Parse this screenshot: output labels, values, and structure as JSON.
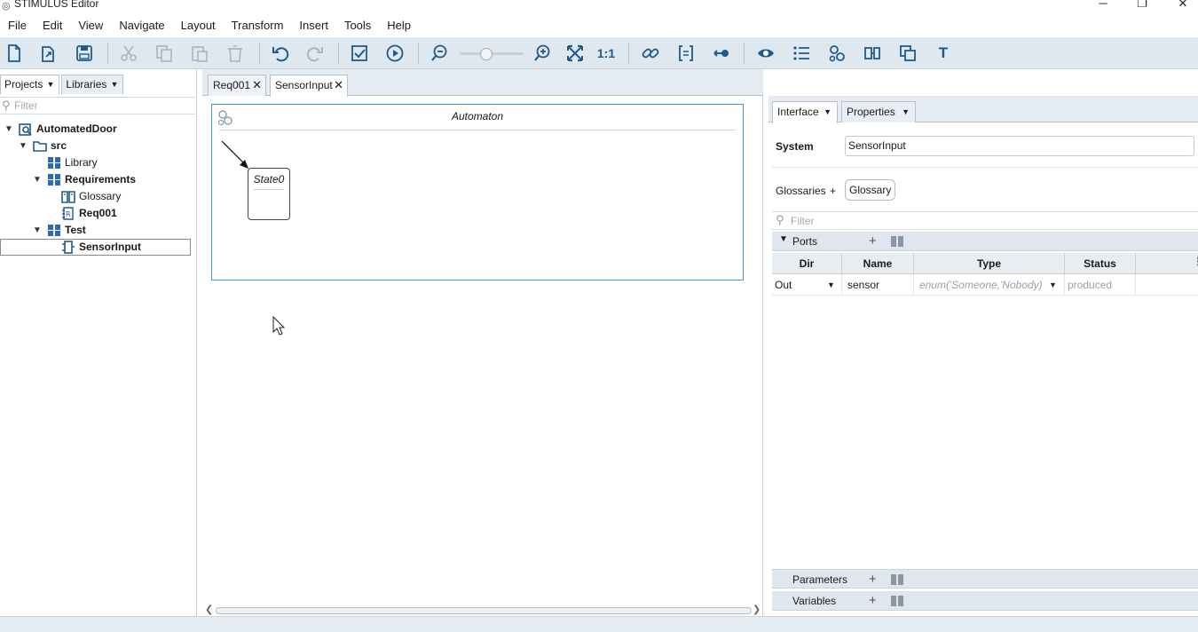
{
  "window": {
    "title": "STIMULUS Editor",
    "minimize": "─",
    "restore": "❐",
    "close": "✕"
  },
  "menu": [
    "File",
    "Edit",
    "View",
    "Navigate",
    "Layout",
    "Transform",
    "Insert",
    "Tools",
    "Help"
  ],
  "toolbar": {
    "zoom_reset_label": "1:1",
    "text_tool_label": "T",
    "zoom_level": 0.4,
    "icon_color": "#1f5a8a",
    "disabled_color": "#a8b4c0"
  },
  "left_panel": {
    "tabs": [
      {
        "label": "Projects",
        "caret": "▼"
      },
      {
        "label": "Libraries",
        "caret": "▼"
      }
    ],
    "filter_placeholder": "Filter",
    "tree": [
      {
        "label": "AutomatedDoor",
        "toggle": "▼"
      },
      {
        "label": "src",
        "toggle": "▼"
      },
      {
        "label": "Library",
        "toggle": ""
      },
      {
        "label": "Requirements",
        "toggle": "▼"
      },
      {
        "label": "Glossary",
        "toggle": ""
      },
      {
        "label": "Req001",
        "toggle": ""
      },
      {
        "label": "Test",
        "toggle": "▼"
      },
      {
        "label": "SensorInput",
        "toggle": ""
      }
    ]
  },
  "editor": {
    "tabs": [
      {
        "label": "Req001",
        "close": "✕"
      },
      {
        "label": "SensorInput",
        "close": "✕"
      }
    ],
    "automaton_title": "Automaton",
    "state_label": "State0",
    "scroll_left": "❮",
    "scroll_right": "❯"
  },
  "right_panel": {
    "tabs": [
      {
        "label": "Interface",
        "caret": "▼"
      },
      {
        "label": "Properties",
        "caret": "▼"
      }
    ],
    "system_label": "System",
    "system_value": "SensorInput",
    "glossaries_label": "Glossaries",
    "glossaries_plus": "+",
    "glossary_chip": "Glossary",
    "filter_placeholder": "Filter",
    "ports": {
      "label": "Ports",
      "toggle": "▼",
      "plus": "+",
      "columns": [
        "Dir",
        "Name",
        "Type",
        "Status"
      ],
      "menu": "⋮",
      "rows": [
        {
          "dir": "Out",
          "dir_caret": "▼",
          "name": "sensor",
          "type": "enum('Someone,'Nobody)",
          "type_caret": "▼",
          "status": "produced"
        }
      ]
    },
    "parameters": {
      "label": "Parameters",
      "plus": "+"
    },
    "variables": {
      "label": "Variables",
      "plus": "+"
    }
  }
}
